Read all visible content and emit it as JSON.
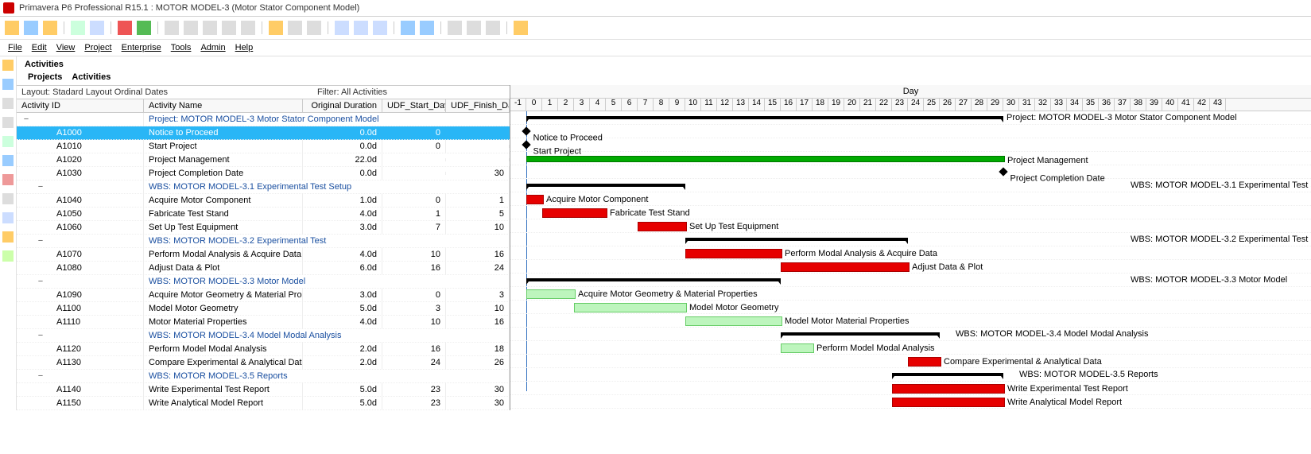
{
  "window": {
    "title": "Primavera P6 Professional R15.1 : MOTOR MODEL-3 (Motor Stator Component Model)"
  },
  "menu": {
    "file": "File",
    "edit": "Edit",
    "view": "View",
    "project": "Project",
    "enterprise": "Enterprise",
    "tools": "Tools",
    "admin": "Admin",
    "help": "Help"
  },
  "section": {
    "activities": "Activities"
  },
  "breadcrumb": {
    "projects": "Projects",
    "activities": "Activities"
  },
  "layout": {
    "label": "Layout: Stadard Layout Ordinal Dates",
    "filter": "Filter: All Activities"
  },
  "cols": {
    "id": "Activity ID",
    "name": "Activity Name",
    "dur": "Original Duration",
    "sd": "UDF_Start_Day",
    "fd": "UDF_Finish_Day"
  },
  "timescale": {
    "unit": "Day",
    "start": -1,
    "end": 43
  },
  "rows": [
    {
      "type": "wbs",
      "indent": 0,
      "name": "Project: MOTOR MODEL-3  Motor Stator Component Model",
      "bar": {
        "kind": "sum",
        "s": 0,
        "f": 30
      },
      "label": "Project: MOTOR MODEL-3  Motor Stator Component Model"
    },
    {
      "type": "act",
      "sel": true,
      "id": "A1000",
      "name": "Notice to Proceed",
      "dur": "0.0d",
      "sd": "0",
      "fd": "",
      "bar": {
        "kind": "ms",
        "s": 0
      },
      "label": "Notice to Proceed"
    },
    {
      "type": "act",
      "id": "A1010",
      "name": "Start Project",
      "dur": "0.0d",
      "sd": "0",
      "fd": "",
      "bar": {
        "kind": "ms",
        "s": 0
      },
      "label": "Start Project"
    },
    {
      "type": "act",
      "id": "A1020",
      "name": "Project Management",
      "dur": "22.0d",
      "sd": "",
      "fd": "",
      "bar": {
        "kind": "green",
        "s": 0,
        "f": 30
      },
      "label": "Project Management"
    },
    {
      "type": "act",
      "id": "A1030",
      "name": "Project Completion Date",
      "dur": "0.0d",
      "sd": "",
      "fd": "30",
      "bar": {
        "kind": "ms",
        "s": 30
      },
      "label": "Project Completion Date"
    },
    {
      "type": "wbs",
      "indent": 1,
      "name": "WBS: MOTOR MODEL-3.1  Experimental Test Setup",
      "bar": {
        "kind": "sum",
        "s": 0,
        "f": 10
      },
      "label": "WBS: MOTOR MODEL-3.1  Experimental Test Setup",
      "labelAt": 38
    },
    {
      "type": "act",
      "id": "A1040",
      "name": "Acquire Motor Component",
      "dur": "1.0d",
      "sd": "0",
      "fd": "1",
      "bar": {
        "kind": "red",
        "s": 0,
        "f": 1
      },
      "label": "Acquire Motor Component"
    },
    {
      "type": "act",
      "id": "A1050",
      "name": "Fabricate Test Stand",
      "dur": "4.0d",
      "sd": "1",
      "fd": "5",
      "bar": {
        "kind": "red",
        "s": 1,
        "f": 5
      },
      "label": "Fabricate Test Stand"
    },
    {
      "type": "act",
      "id": "A1060",
      "name": "Set Up Test Equipment",
      "dur": "3.0d",
      "sd": "7",
      "fd": "10",
      "bar": {
        "kind": "red",
        "s": 7,
        "f": 10
      },
      "label": "Set Up Test Equipment"
    },
    {
      "type": "wbs",
      "indent": 1,
      "name": "WBS: MOTOR MODEL-3.2  Experimental Test",
      "bar": {
        "kind": "sum",
        "s": 10,
        "f": 24
      },
      "label": "WBS: MOTOR MODEL-3.2  Experimental Test",
      "labelAt": 38
    },
    {
      "type": "act",
      "id": "A1070",
      "name": "Perform Modal Analysis & Acquire Data",
      "dur": "4.0d",
      "sd": "10",
      "fd": "16",
      "bar": {
        "kind": "red",
        "s": 10,
        "f": 16
      },
      "label": "Perform Modal Analysis & Acquire Data"
    },
    {
      "type": "act",
      "id": "A1080",
      "name": "Adjust Data & Plot",
      "dur": "6.0d",
      "sd": "16",
      "fd": "24",
      "bar": {
        "kind": "red",
        "s": 16,
        "f": 24
      },
      "label": "Adjust Data & Plot"
    },
    {
      "type": "wbs",
      "indent": 1,
      "name": "WBS: MOTOR MODEL-3.3  Motor Model",
      "bar": {
        "kind": "sum",
        "s": 0,
        "f": 16
      },
      "label": "WBS: MOTOR MODEL-3.3  Motor Model",
      "labelAt": 38
    },
    {
      "type": "act",
      "id": "A1090",
      "name": "Acquire Motor Geometry & Material Properties",
      "dur": "3.0d",
      "sd": "0",
      "fd": "3",
      "bar": {
        "kind": "lgreen",
        "s": 0,
        "f": 3
      },
      "label": "Acquire Motor Geometry & Material Properties"
    },
    {
      "type": "act",
      "id": "A1100",
      "name": "Model Motor Geometry",
      "dur": "5.0d",
      "sd": "3",
      "fd": "10",
      "bar": {
        "kind": "lgreen",
        "s": 3,
        "f": 10
      },
      "label": "Model Motor Geometry"
    },
    {
      "type": "act",
      "id": "A1110",
      "name": "Motor Material Properties",
      "dur": "4.0d",
      "sd": "10",
      "fd": "16",
      "bar": {
        "kind": "lgreen",
        "s": 10,
        "f": 16
      },
      "label": "Model Motor Material Properties"
    },
    {
      "type": "wbs",
      "indent": 1,
      "name": "WBS: MOTOR MODEL-3.4  Model Modal Analysis",
      "bar": {
        "kind": "sum",
        "s": 16,
        "f": 26
      },
      "label": "WBS: MOTOR MODEL-3.4  Model Modal Analysis",
      "labelAt": 27
    },
    {
      "type": "act",
      "id": "A1120",
      "name": "Perform Model Modal Analysis",
      "dur": "2.0d",
      "sd": "16",
      "fd": "18",
      "bar": {
        "kind": "lgreen",
        "s": 16,
        "f": 18
      },
      "label": "Perform Model Modal Analysis"
    },
    {
      "type": "act",
      "id": "A1130",
      "name": "Compare Experimental & Analytical Data",
      "dur": "2.0d",
      "sd": "24",
      "fd": "26",
      "bar": {
        "kind": "red",
        "s": 24,
        "f": 26
      },
      "label": "Compare Experimental & Analytical Data"
    },
    {
      "type": "wbs",
      "indent": 1,
      "name": "WBS: MOTOR MODEL-3.5  Reports",
      "bar": {
        "kind": "sum",
        "s": 23,
        "f": 30
      },
      "label": "WBS: MOTOR MODEL-3.5  Reports",
      "labelAt": 31
    },
    {
      "type": "act",
      "id": "A1140",
      "name": "Write Experimental Test Report",
      "dur": "5.0d",
      "sd": "23",
      "fd": "30",
      "bar": {
        "kind": "red",
        "s": 23,
        "f": 30
      },
      "label": "Write Experimental Test Report"
    },
    {
      "type": "act",
      "id": "A1150",
      "name": "Write Analytical Model Report",
      "dur": "5.0d",
      "sd": "23",
      "fd": "30",
      "bar": {
        "kind": "red",
        "s": 23,
        "f": 30
      },
      "label": "Write Analytical Model Report"
    }
  ],
  "chart_data": {
    "type": "gantt",
    "unit": "Day",
    "range": [
      -1,
      43
    ],
    "data_date": 0,
    "tasks": [
      {
        "id": "A1000",
        "name": "Notice to Proceed",
        "start": 0,
        "finish": 0,
        "milestone": true
      },
      {
        "id": "A1010",
        "name": "Start Project",
        "start": 0,
        "finish": 0,
        "milestone": true
      },
      {
        "id": "A1020",
        "name": "Project Management",
        "start": 0,
        "finish": 30,
        "style": "green"
      },
      {
        "id": "A1030",
        "name": "Project Completion Date",
        "start": 30,
        "finish": 30,
        "milestone": true
      },
      {
        "id": "A1040",
        "name": "Acquire Motor Component",
        "start": 0,
        "finish": 1,
        "style": "red"
      },
      {
        "id": "A1050",
        "name": "Fabricate Test Stand",
        "start": 1,
        "finish": 5,
        "style": "red"
      },
      {
        "id": "A1060",
        "name": "Set Up Test Equipment",
        "start": 7,
        "finish": 10,
        "style": "red"
      },
      {
        "id": "A1070",
        "name": "Perform Modal Analysis & Acquire Data",
        "start": 10,
        "finish": 16,
        "style": "red"
      },
      {
        "id": "A1080",
        "name": "Adjust Data & Plot",
        "start": 16,
        "finish": 24,
        "style": "red"
      },
      {
        "id": "A1090",
        "name": "Acquire Motor Geometry & Material Properties",
        "start": 0,
        "finish": 3,
        "style": "lgreen"
      },
      {
        "id": "A1100",
        "name": "Model Motor Geometry",
        "start": 3,
        "finish": 10,
        "style": "lgreen"
      },
      {
        "id": "A1110",
        "name": "Model Motor Material Properties",
        "start": 10,
        "finish": 16,
        "style": "lgreen"
      },
      {
        "id": "A1120",
        "name": "Perform Model Modal Analysis",
        "start": 16,
        "finish": 18,
        "style": "lgreen"
      },
      {
        "id": "A1130",
        "name": "Compare Experimental & Analytical Data",
        "start": 24,
        "finish": 26,
        "style": "red"
      },
      {
        "id": "A1140",
        "name": "Write Experimental Test Report",
        "start": 23,
        "finish": 30,
        "style": "red"
      },
      {
        "id": "A1150",
        "name": "Write Analytical Model Report",
        "start": 23,
        "finish": 30,
        "style": "red"
      }
    ],
    "summaries": [
      {
        "name": "Project: MOTOR MODEL-3",
        "start": 0,
        "finish": 30
      },
      {
        "name": "Experimental Test Setup",
        "start": 0,
        "finish": 10
      },
      {
        "name": "Experimental Test",
        "start": 10,
        "finish": 24
      },
      {
        "name": "Motor Model",
        "start": 0,
        "finish": 16
      },
      {
        "name": "Model Modal Analysis",
        "start": 16,
        "finish": 26
      },
      {
        "name": "Reports",
        "start": 23,
        "finish": 30
      }
    ]
  }
}
